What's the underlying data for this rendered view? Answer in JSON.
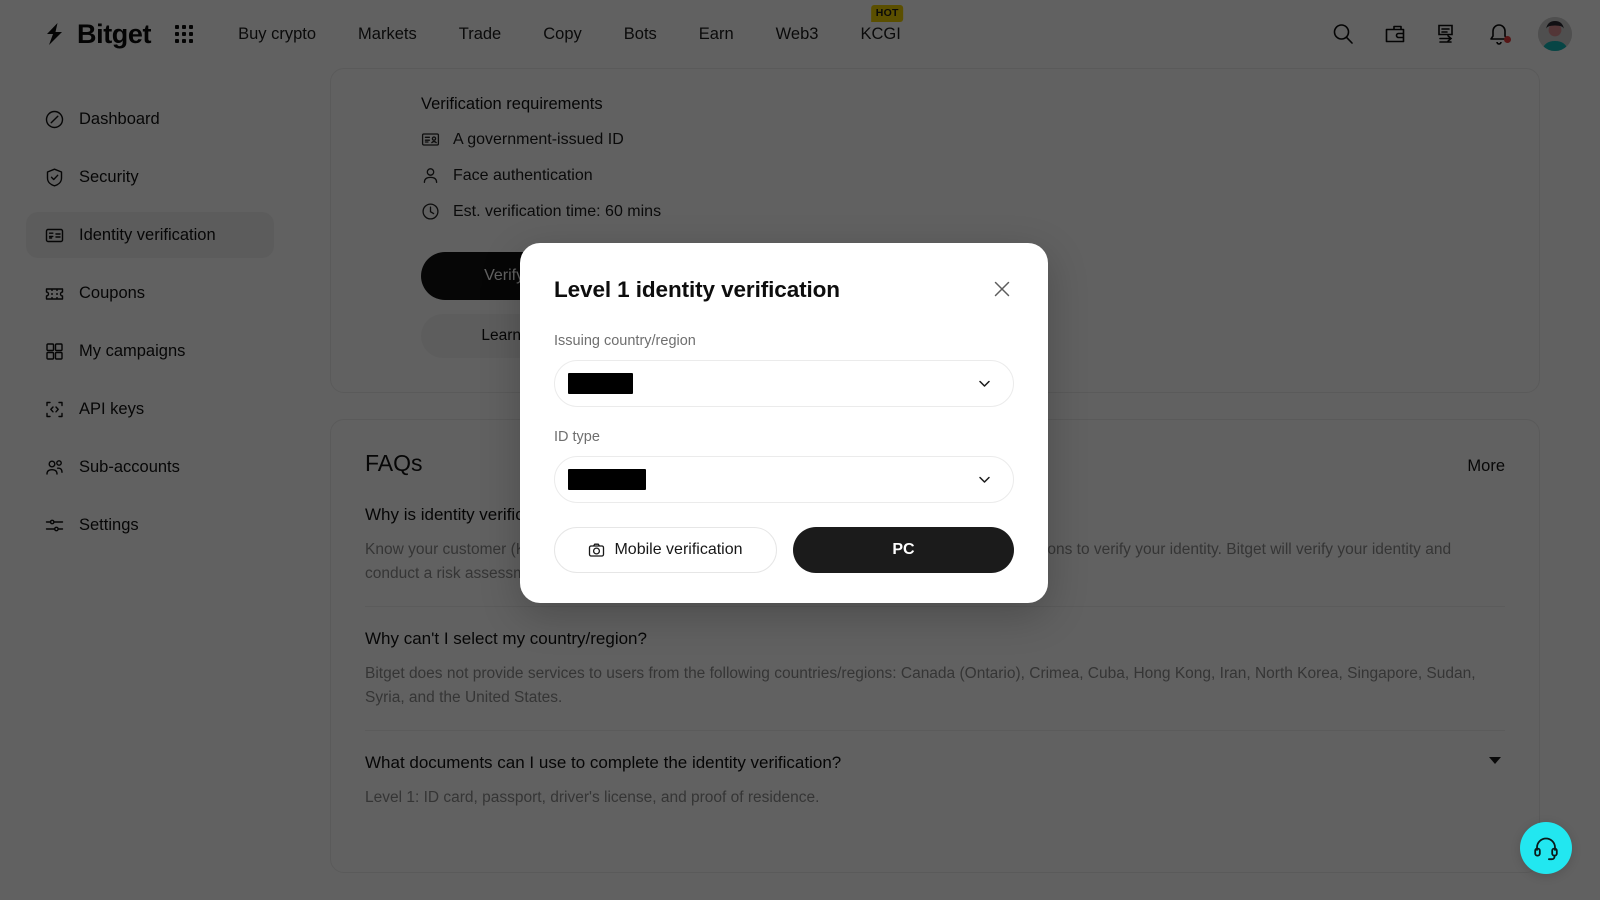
{
  "brand": {
    "name": "Bitget"
  },
  "topnav": {
    "items": [
      {
        "label": "Buy crypto",
        "badge": ""
      },
      {
        "label": "Markets",
        "badge": ""
      },
      {
        "label": "Trade",
        "badge": ""
      },
      {
        "label": "Copy",
        "badge": ""
      },
      {
        "label": "Bots",
        "badge": ""
      },
      {
        "label": "Earn",
        "badge": ""
      },
      {
        "label": "Web3",
        "badge": ""
      },
      {
        "label": "KCGI",
        "badge": "HOT"
      }
    ],
    "badge_color": "#f0d000",
    "icons": [
      "search-icon",
      "wallet-icon",
      "orders-icon",
      "bell-icon",
      "avatar"
    ]
  },
  "sidebar": {
    "items": [
      {
        "label": "Dashboard",
        "icon": "compass-icon",
        "active": false
      },
      {
        "label": "Security",
        "icon": "shield-check-icon",
        "active": false
      },
      {
        "label": "Identity verification",
        "icon": "id-card-icon",
        "active": true
      },
      {
        "label": "Coupons",
        "icon": "ticket-icon",
        "active": false
      },
      {
        "label": "My campaigns",
        "icon": "grid-squares-icon",
        "active": false
      },
      {
        "label": "API keys",
        "icon": "code-brackets-icon",
        "active": false
      },
      {
        "label": "Sub-accounts",
        "icon": "users-icon",
        "active": false
      },
      {
        "label": "Settings",
        "icon": "sliders-icon",
        "active": false
      }
    ]
  },
  "requirements": {
    "title": "Verification requirements",
    "rows": [
      {
        "label": "A government-issued ID",
        "icon": "id-document-icon"
      },
      {
        "label": "Face authentication",
        "icon": "person-icon"
      },
      {
        "label": "Est. verification time: 60 mins",
        "icon": "clock-icon"
      }
    ],
    "primary_button": "Verify now",
    "secondary_button": "Learn more"
  },
  "faqs": {
    "title": "FAQs",
    "more_label": "More",
    "items": [
      {
        "question": "Why is identity verification required?",
        "answer": "Know your customer (KYC) is a process used by financial institutions and other regulated organisations to verify your identity. Bitget will verify your identity and conduct a risk assessment to mitigate risk."
      },
      {
        "question": "Why can't I select my country/region?",
        "answer": "Bitget does not provide services to users from the following countries/regions: Canada (Ontario), Crimea, Cuba, Hong Kong, Iran, North Korea, Singapore, Sudan, Syria, and the United States."
      },
      {
        "question": "What documents can I use to complete the identity verification?",
        "answer": "Level 1: ID card, passport, driver's license, and proof of residence."
      }
    ]
  },
  "support": {
    "icon": "headset-icon",
    "color": "#22e7f0"
  },
  "modal": {
    "title": "Level 1 identity verification",
    "close_icon": "close-icon",
    "fields": [
      {
        "label": "Issuing country/region",
        "value": "",
        "redacted": true,
        "redact_width": 65,
        "caret": "chevron-down-icon"
      },
      {
        "label": "ID type",
        "value": "",
        "redacted": true,
        "redact_width": 78,
        "caret": "chevron-down-icon"
      }
    ],
    "actions": {
      "mobile_label": "Mobile verification",
      "mobile_icon": "camera-icon",
      "pc_label": "PC"
    }
  }
}
